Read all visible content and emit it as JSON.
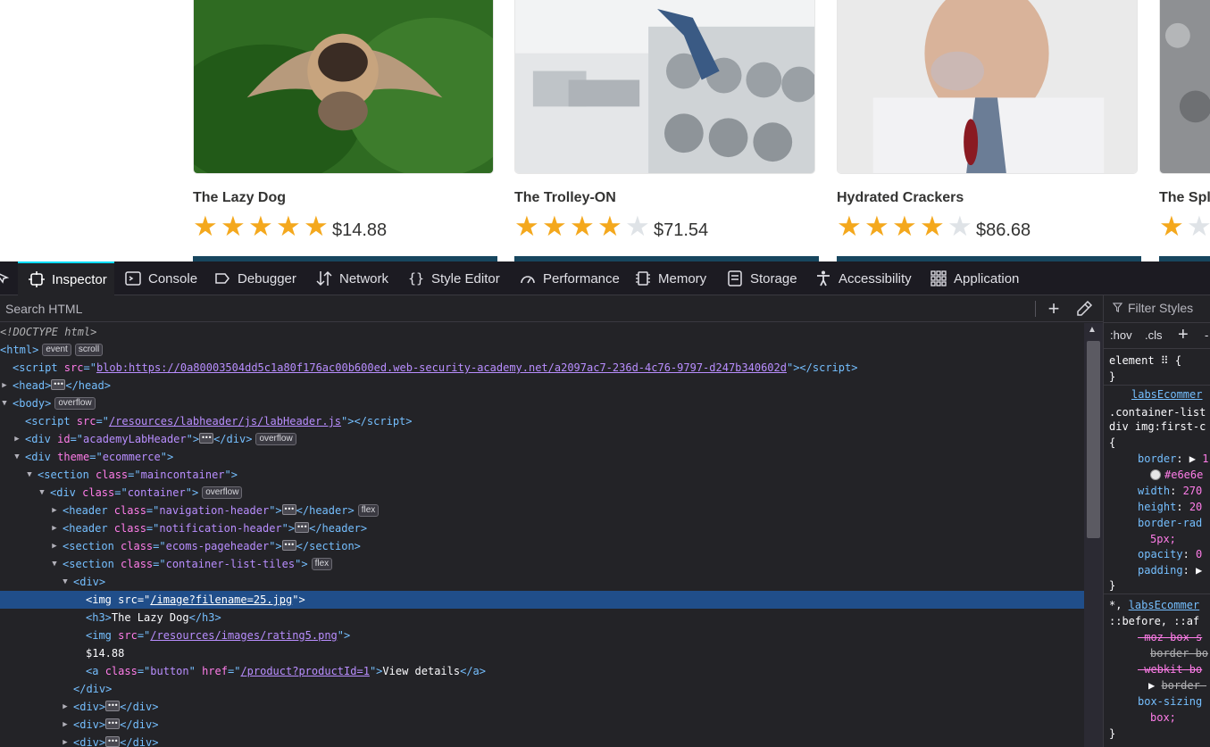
{
  "products": [
    {
      "title": "The Lazy Dog",
      "price": "$14.88",
      "rating": 5
    },
    {
      "title": "The Trolley-ON",
      "price": "$71.54",
      "rating": 4
    },
    {
      "title": "Hydrated Crackers",
      "price": "$86.68",
      "rating": 4
    },
    {
      "title": "The Spl",
      "price": "",
      "rating": 1
    }
  ],
  "devtools": {
    "tabs": [
      {
        "label": "Inspector",
        "icon": "inspector-icon"
      },
      {
        "label": "Console",
        "icon": "console-icon"
      },
      {
        "label": "Debugger",
        "icon": "debugger-icon"
      },
      {
        "label": "Network",
        "icon": "network-icon"
      },
      {
        "label": "Style Editor",
        "icon": "style-editor-icon"
      },
      {
        "label": "Performance",
        "icon": "performance-icon"
      },
      {
        "label": "Memory",
        "icon": "memory-icon"
      },
      {
        "label": "Storage",
        "icon": "storage-icon"
      },
      {
        "label": "Accessibility",
        "icon": "accessibility-icon"
      },
      {
        "label": "Application",
        "icon": "application-icon"
      }
    ],
    "search_placeholder": "Search HTML",
    "filter_styles_placeholder": "Filter Styles",
    "hov_label": ":hov",
    "cls_label": ".cls",
    "tree": {
      "doctype": "<!DOCTYPE html>",
      "html_badges": [
        "event",
        "scroll"
      ],
      "script_src": "blob:https://0a80003504dd5c1a80f176ac00b600ed.web-security-academy.net/a2097ac7-236d-4c76-9797-d247b340602d",
      "labheader_src": "/resources/labheader/js/labHeader.js",
      "body_badge": "overflow",
      "academy_id": "academyLabHeader",
      "academy_badge": "overflow",
      "theme_val": "ecommerce",
      "maincontainer": "maincontainer",
      "container": "container",
      "container_badge": "overflow",
      "nav_header": "navigation-header",
      "nav_badge": "flex",
      "notif_header": "notification-header",
      "pageheader": "ecoms-pageheader",
      "list_tiles": "container-list-tiles",
      "list_badge": "flex",
      "img_src": "/image?filename=25.jpg",
      "h3_text": "The Lazy Dog",
      "rating_src": "/resources/images/rating5.png",
      "price_text": "$14.88",
      "btn_class": "button",
      "btn_href": "/product?productId=1",
      "btn_text": "View details"
    },
    "rules": {
      "element_sel": "element",
      "labs_link": "labsEcommer",
      "sel1": ".container-list",
      "sel2": "div img:first-c",
      "border_prop": "border",
      "border_val": "1",
      "color_val": "#e6e6e",
      "width_prop": "width",
      "width_val": "270",
      "height_prop": "height",
      "height_val": "20",
      "radius_prop": "border-rad",
      "radius_val": "5px;",
      "opacity_prop": "opacity",
      "opacity_val": "0",
      "padding_prop": "padding",
      "labs_link2": "labsEcommer",
      "sel3": "::before, ::af",
      "moz": "-moz-box-s",
      "border_box": "border-bo",
      "webkit": "-webkit-bo",
      "border_b2": "border-",
      "box_sizing": "box-sizing",
      "box_val": "box;"
    }
  }
}
